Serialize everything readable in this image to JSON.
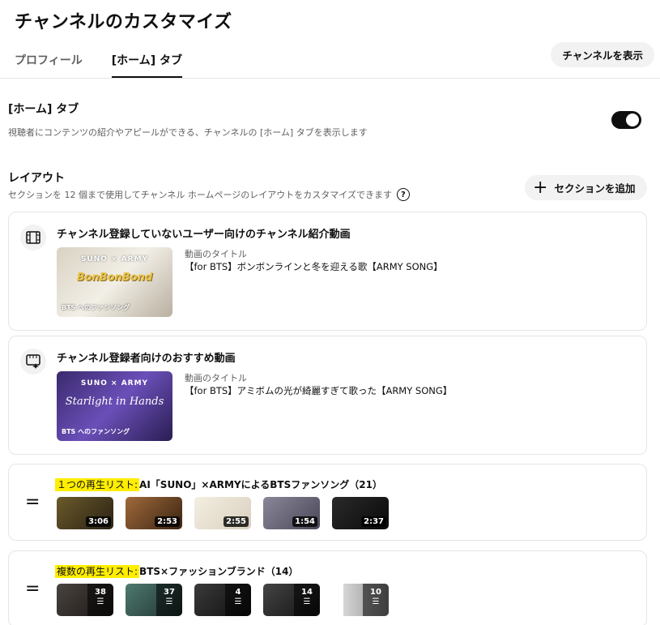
{
  "page": {
    "title": "チャンネルのカスタマイズ",
    "tabs": [
      {
        "label": "プロフィール",
        "active": false
      },
      {
        "label": "[ホーム] タブ",
        "active": true
      }
    ],
    "view_channel_label": "チャンネルを表示"
  },
  "home_tab": {
    "heading": "[ホーム] タブ",
    "description": "視聴者にコンテンツの紹介やアピールができる、チャンネルの [ホーム] タブを表示します",
    "enabled": true
  },
  "layout": {
    "heading": "レイアウト",
    "description": "セクションを 12 個まで使用してチャンネル ホームページのレイアウトをカスタマイズできます",
    "help_icon": "?",
    "add_section_label": "セクションを追加",
    "add_icon": "+"
  },
  "sections": {
    "trailer": {
      "title": "チャンネル登録していないユーザー向けのチャンネル紹介動画",
      "icon": "film-icon",
      "video_label": "動画のタイトル",
      "video_title": "【for BTS】ボンボンラインと冬を迎える歌【ARMY SONG】",
      "thumb_top": "SUNO × ARMY",
      "thumb_main": "BonBonBond",
      "thumb_bottom": "BTS へのファンソング"
    },
    "featured": {
      "title": "チャンネル登録者向けのおすすめ動画",
      "icon": "sparkle-video-icon",
      "video_label": "動画のタイトル",
      "video_title": "【for BTS】アミボムの光が綺麗すぎて歌った【ARMY SONG】",
      "thumb_top": "SUNO × ARMY",
      "thumb_main": "Starlight in Hands",
      "thumb_bottom": "BTS へのファンソング"
    },
    "single_playlist": {
      "label": "１つの再生リスト:",
      "title": "AI「SUNO」×ARMYによるBTSファンソング（21）",
      "thumbs": [
        {
          "duration": "3:06",
          "color": "#3a2f1a"
        },
        {
          "duration": "2:53",
          "color": "#5a3a1f"
        },
        {
          "duration": "2:55",
          "color": "#ece6d8"
        },
        {
          "duration": "1:54",
          "color": "#6c6a78"
        },
        {
          "duration": "2:37",
          "color": "#151515"
        }
      ]
    },
    "multi_playlist": {
      "label": "複数の再生リスト:",
      "title": "BTS×ファッションブランド（14）",
      "thumbs": [
        {
          "count": "38",
          "color": "#2a2624"
        },
        {
          "count": "37",
          "color": "#2d4a44"
        },
        {
          "count": "4",
          "color": "#1e1e1e"
        },
        {
          "count": "14",
          "color": "#2a2a2a"
        },
        {
          "count": "10",
          "color": "#cfcfcf"
        }
      ]
    }
  },
  "colors": {
    "toggle_on": "#0f0f0f",
    "highlight": "#ffee00",
    "chip_bg": "#f2f2f2"
  }
}
